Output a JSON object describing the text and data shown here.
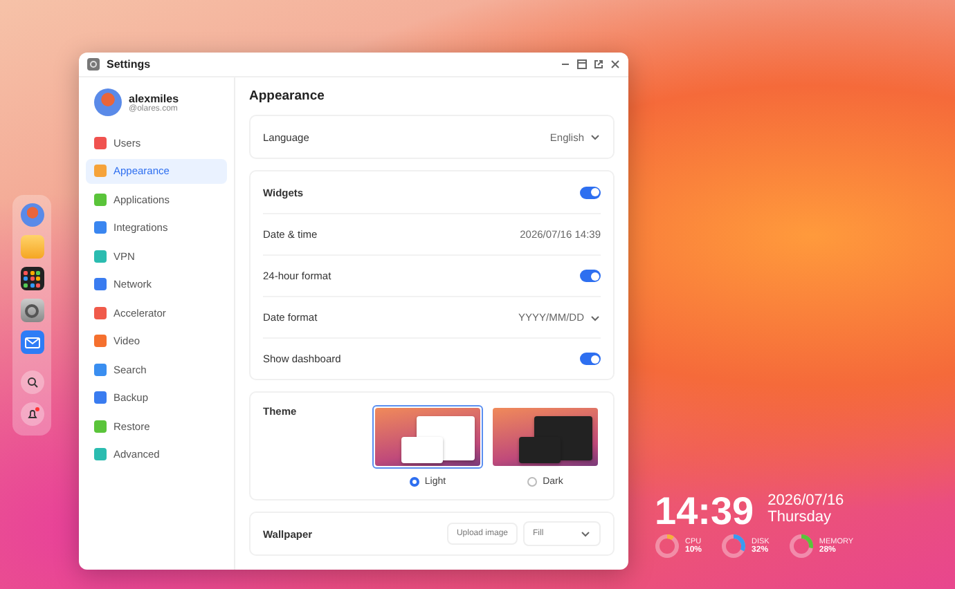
{
  "window": {
    "title": "Settings"
  },
  "profile": {
    "name": "alexmiles",
    "domain": "@olares.com"
  },
  "sidebar": {
    "items": [
      {
        "label": "Users",
        "selected": false,
        "color": "#f0524f"
      },
      {
        "label": "Appearance",
        "selected": true,
        "color": "#f6a33a"
      },
      {
        "label": "Applications",
        "selected": false,
        "color": "#5ac43a"
      },
      {
        "label": "Integrations",
        "selected": false,
        "color": "#3a86f0"
      },
      {
        "label": "VPN",
        "selected": false,
        "color": "#2bbcb0"
      },
      {
        "label": "Network",
        "selected": false,
        "color": "#3a7cf0"
      },
      {
        "label": "Accelerator",
        "selected": false,
        "color": "#f05a4a"
      },
      {
        "label": "Video",
        "selected": false,
        "color": "#f5702e"
      },
      {
        "label": "Search",
        "selected": false,
        "color": "#3a8ef0"
      },
      {
        "label": "Backup",
        "selected": false,
        "color": "#3a7cf0"
      },
      {
        "label": "Restore",
        "selected": false,
        "color": "#5ac43a"
      },
      {
        "label": "Advanced",
        "selected": false,
        "color": "#2bbcb0"
      }
    ]
  },
  "page": {
    "title": "Appearance",
    "groups": [
      [
        {
          "kind": "select",
          "label": "Language",
          "value": "English"
        }
      ],
      [
        {
          "kind": "toggle",
          "label": "Widgets",
          "on": true
        },
        {
          "kind": "value",
          "label": "Date & time",
          "value": "2026/07/16 14:39"
        },
        {
          "kind": "toggle",
          "label": "24-hour format",
          "on": true
        },
        {
          "kind": "select",
          "label": "Date format",
          "value": "YYYY/MM/DD"
        },
        {
          "kind": "toggle",
          "label": "Show dashboard",
          "on": true
        }
      ]
    ],
    "theme": {
      "label": "Theme",
      "options": [
        {
          "label": "Light",
          "selected": true,
          "kind": "light"
        },
        {
          "label": "Dark",
          "selected": false,
          "kind": "dark"
        }
      ]
    },
    "wallpaper": {
      "label": "Wallpaper",
      "upload": "Upload image",
      "fit": "Fill"
    }
  },
  "dock": {
    "items": [
      {
        "kind": "avatar"
      },
      {
        "kind": "folder"
      },
      {
        "kind": "launcher"
      },
      {
        "kind": "settings"
      },
      {
        "kind": "mail"
      },
      {
        "kind": "search"
      },
      {
        "kind": "bell"
      }
    ]
  },
  "widget": {
    "time": "14:39",
    "date": "2026/07/16",
    "weekday": "Thursday",
    "meters": [
      {
        "label": "CPU",
        "reading": "10%",
        "level": 0.1,
        "color": "#f6b13a"
      },
      {
        "label": "DISK",
        "reading": "32%",
        "level": 0.32,
        "color": "#3a9af0"
      },
      {
        "label": "MEMORY",
        "reading": "28%",
        "level": 0.28,
        "color": "#5ac43a"
      }
    ]
  }
}
